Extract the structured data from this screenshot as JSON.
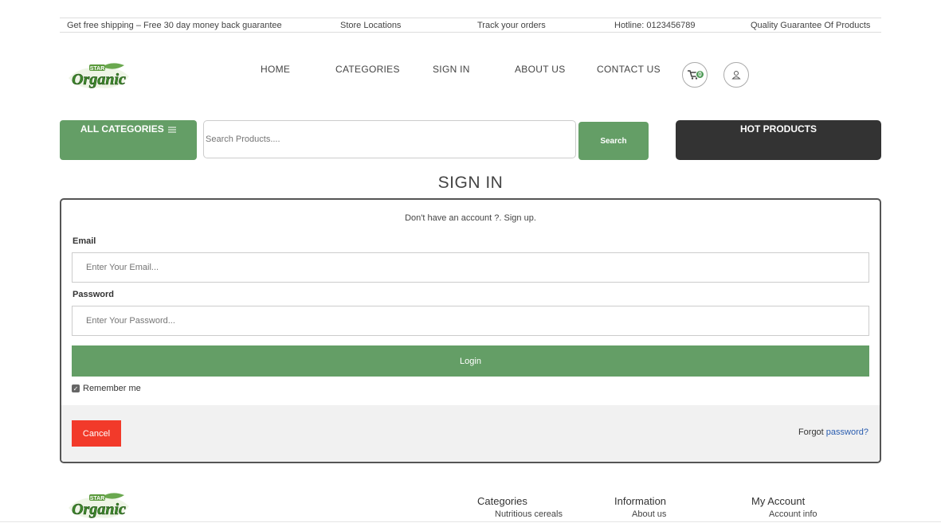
{
  "topbar": {
    "shipping": "Get free shipping – Free 30 day money back guarantee",
    "stores": "Store Locations",
    "track": "Track your orders",
    "hotline": "Hotline: 0123456789",
    "quality": "Quality Guarantee Of Products"
  },
  "logo": {
    "star": "STAR",
    "name": "Organic"
  },
  "nav": {
    "home": "HOME",
    "categories": "CATEGORIES",
    "signin": "SIGN IN",
    "about": "ABOUT US",
    "contact": "CONTACT US"
  },
  "cart": {
    "count": "0",
    "icon": "cart-icon"
  },
  "user": {
    "icon": "user-icon"
  },
  "search": {
    "all_categories": "ALL CATEGORIES",
    "placeholder": "Search Products....",
    "button": "Search",
    "hot_products": "HOT PRODUCTS"
  },
  "signin_form": {
    "title": "SIGN IN",
    "signup_prompt": "Don't have an account ?. Sign up.",
    "email_label": "Email",
    "email_placeholder": "Enter Your Email...",
    "password_label": "Password",
    "password_placeholder": "Enter Your Password...",
    "login": "Login",
    "remember": "Remember me",
    "remember_checked": true,
    "cancel": "Cancel",
    "forgot_prefix": "Forgot ",
    "forgot_link": "password?"
  },
  "footer": {
    "categories_title": "Categories",
    "categories_link": "Nutritious cereals",
    "information_title": "Information",
    "information_link": "About us",
    "account_title": "My Account",
    "account_link": "Account info"
  },
  "colors": {
    "green": "#649e66",
    "dark": "#333333",
    "cancel_red": "#f23a2a",
    "link_blue": "#2a5db0"
  }
}
